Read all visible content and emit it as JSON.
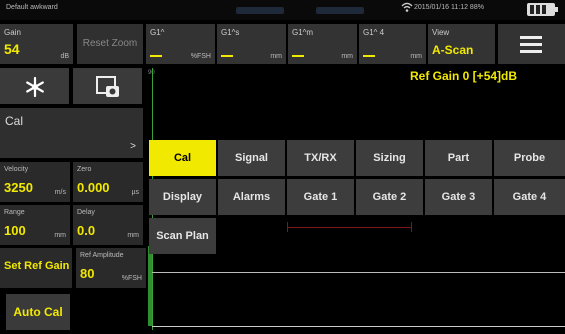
{
  "status_bar": {
    "device_name": "Default awkward",
    "datetime": "2015/01/16  11:12  88%"
  },
  "header": {
    "gain": {
      "label": "Gain",
      "value": "54",
      "unit": "dB"
    },
    "reset_zoom_label": "Reset Zoom",
    "g1": {
      "label": "G1^",
      "unit": "%FSH"
    },
    "g1_sound_path": {
      "label": "G1^s",
      "unit": "mm"
    },
    "g1_depth": {
      "label": "G1^m",
      "unit": "mm"
    },
    "g1_surface": {
      "label": "G1^ 4",
      "unit": "mm"
    },
    "view": {
      "label": "View",
      "value": "A-Scan"
    }
  },
  "left_panel": {
    "section_title": "Cal",
    "velocity": {
      "label": "Velocity",
      "value": "3250",
      "unit": "m/s"
    },
    "zero": {
      "label": "Zero",
      "value": "0.000",
      "unit": "µs"
    },
    "range": {
      "label": "Range",
      "value": "100",
      "unit": "mm"
    },
    "delay": {
      "label": "Delay",
      "value": "0.0",
      "unit": "mm"
    },
    "set_ref_gain_label": "Set Ref Gain",
    "ref_amplitude": {
      "label": "Ref Amplitude",
      "value": "80",
      "unit": "%FSH"
    },
    "auto_cal_label": "Auto Cal"
  },
  "ascan": {
    "ref_gain_text": "Ref Gain 0 [+54]dB",
    "axis_top_label": "90"
  },
  "menu_tabs": {
    "row1": [
      "Cal",
      "Signal",
      "TX/RX",
      "Sizing",
      "Part",
      "Probe"
    ],
    "row2": [
      "Display",
      "Alarms",
      "Gate 1",
      "Gate 2",
      "Gate 3",
      "Gate 4"
    ],
    "row3": [
      "Scan Plan"
    ],
    "active": "Cal"
  },
  "colors": {
    "accent": "#f2e900",
    "panel": "#333333",
    "trace": "#2d8f2d",
    "gate": "#7a1a1a"
  }
}
